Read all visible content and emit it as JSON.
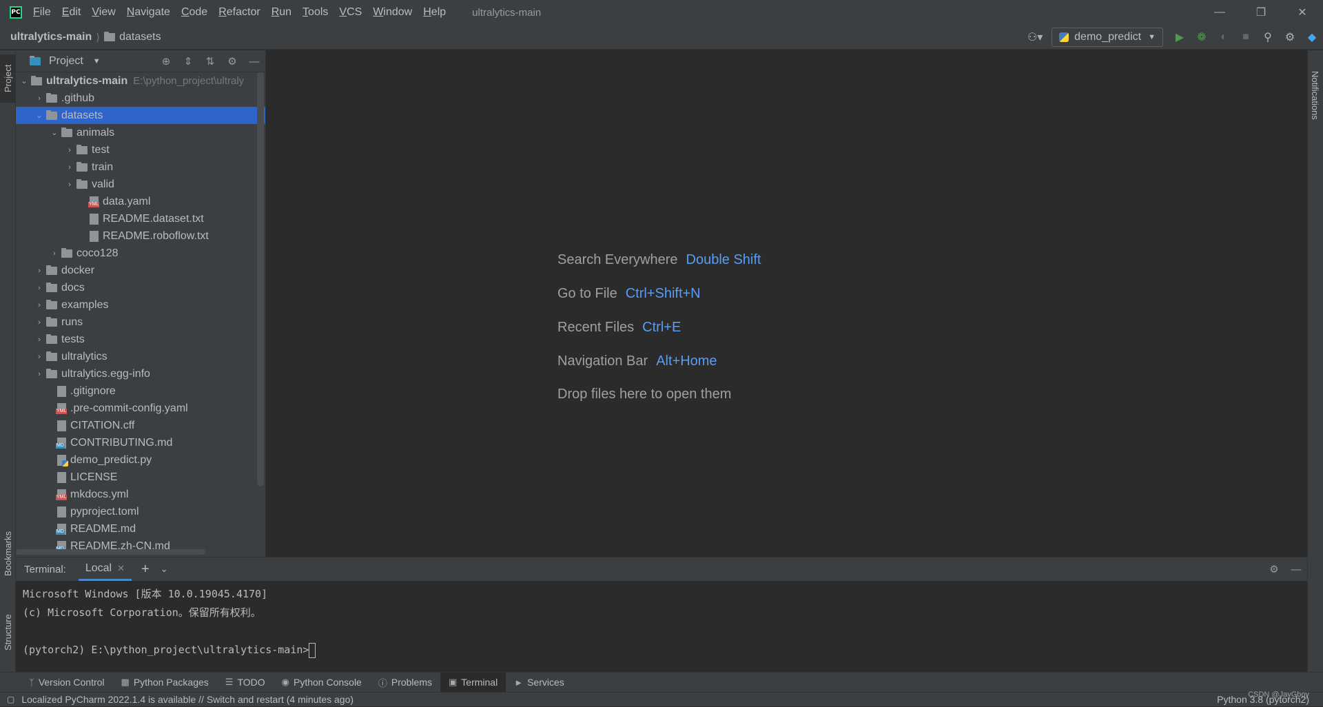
{
  "menubar": {
    "items": [
      "File",
      "Edit",
      "View",
      "Navigate",
      "Code",
      "Refactor",
      "Run",
      "Tools",
      "VCS",
      "Window",
      "Help"
    ],
    "window_title": "ultralytics-main",
    "logo_text": "PC"
  },
  "navbar": {
    "root": "ultralytics-main",
    "current": "datasets",
    "run_config": "demo_predict"
  },
  "left_strip": {
    "project": "Project",
    "bookmarks": "Bookmarks",
    "structure": "Structure"
  },
  "right_strip": {
    "notifications": "Notifications"
  },
  "project_panel": {
    "title": "Project",
    "root_name": "ultralytics-main",
    "root_path": "E:\\python_project\\ultraly",
    "items": [
      {
        "label": ".github"
      },
      {
        "label": "datasets"
      },
      {
        "label": "animals"
      },
      {
        "label": "test"
      },
      {
        "label": "train"
      },
      {
        "label": "valid"
      },
      {
        "label": "data.yaml"
      },
      {
        "label": "README.dataset.txt"
      },
      {
        "label": "README.roboflow.txt"
      },
      {
        "label": "coco128"
      },
      {
        "label": "docker"
      },
      {
        "label": "docs"
      },
      {
        "label": "examples"
      },
      {
        "label": "runs"
      },
      {
        "label": "tests"
      },
      {
        "label": "ultralytics"
      },
      {
        "label": "ultralytics.egg-info"
      },
      {
        "label": ".gitignore"
      },
      {
        "label": ".pre-commit-config.yaml"
      },
      {
        "label": "CITATION.cff"
      },
      {
        "label": "CONTRIBUTING.md"
      },
      {
        "label": "demo_predict.py"
      },
      {
        "label": "LICENSE"
      },
      {
        "label": "mkdocs.yml"
      },
      {
        "label": "pyproject.toml"
      },
      {
        "label": "README.md"
      },
      {
        "label": "README.zh-CN.md"
      }
    ]
  },
  "editor": {
    "hints": [
      {
        "label": "Search Everywhere",
        "key": "Double Shift"
      },
      {
        "label": "Go to File",
        "key": "Ctrl+Shift+N"
      },
      {
        "label": "Recent Files",
        "key": "Ctrl+E"
      },
      {
        "label": "Navigation Bar",
        "key": "Alt+Home"
      },
      {
        "label": "Drop files here to open them",
        "key": ""
      }
    ]
  },
  "terminal": {
    "label": "Terminal:",
    "tab": "Local",
    "lines": [
      "Microsoft Windows [版本 10.0.19045.4170]",
      "(c) Microsoft Corporation。保留所有权利。",
      "",
      "(pytorch2) E:\\python_project\\ultralytics-main>"
    ]
  },
  "bottom_tabs": [
    "Version Control",
    "Python Packages",
    "TODO",
    "Python Console",
    "Problems",
    "Terminal",
    "Services"
  ],
  "statusbar": {
    "message": "Localized PyCharm 2022.1.4 is available // Switch and restart (4 minutes ago)",
    "interpreter": "Python 3.8 (pytorch2)",
    "watermark": "CSDN @JayGboy"
  }
}
